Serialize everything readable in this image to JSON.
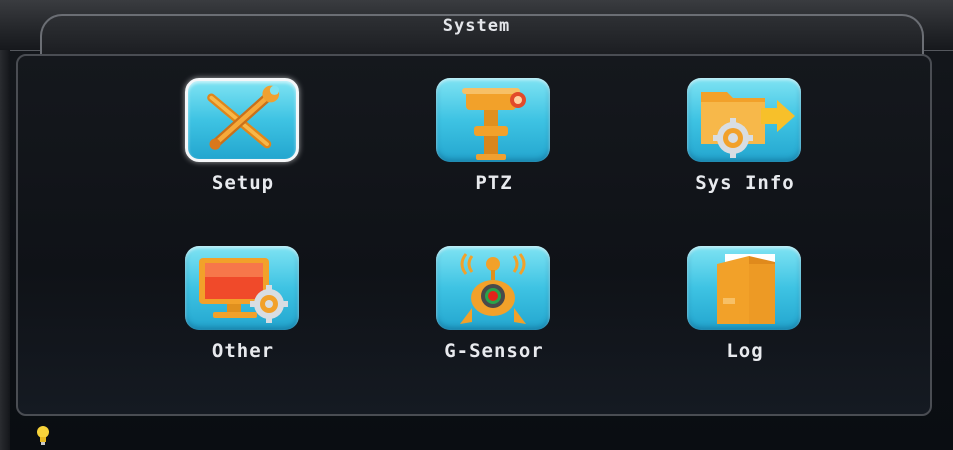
{
  "window": {
    "title": "System"
  },
  "menu": {
    "items": [
      {
        "label": "Setup",
        "icon": "tools-icon",
        "selected": true
      },
      {
        "label": "PTZ",
        "icon": "ptz-camera-icon",
        "selected": false
      },
      {
        "label": "Sys Info",
        "icon": "folder-gear-icon",
        "selected": false
      },
      {
        "label": "Other",
        "icon": "monitor-gear-icon",
        "selected": false
      },
      {
        "label": "G-Sensor",
        "icon": "gsensor-icon",
        "selected": false
      },
      {
        "label": "Log",
        "icon": "log-folder-icon",
        "selected": false
      }
    ]
  },
  "status": {
    "indicator_icon": "lightbulb-icon"
  },
  "colors": {
    "icon_bg": "#3ec3e3",
    "icon_accent": "#f2a12a",
    "label": "#e8eaee",
    "selection_border": "#f4f6f8"
  }
}
